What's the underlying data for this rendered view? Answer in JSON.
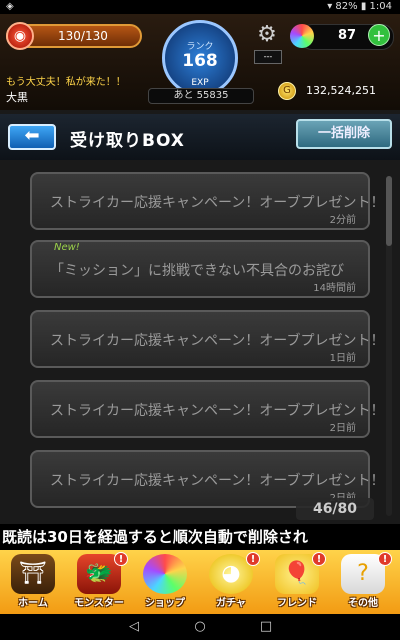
{
  "status_bar": {
    "left_icon": "android-icon",
    "battery": "82%",
    "time": "1:04"
  },
  "player": {
    "hp": "130/130",
    "rank_label": "ランク",
    "rank": "168",
    "exp_label": "EXP",
    "exp_remaining": "あと 55835",
    "orbs": "87",
    "coins": "132,524,251",
    "message": "もう大丈夫！私が来た！！",
    "name": "大黒"
  },
  "header": {
    "title": "受け取りBOX",
    "bulk_delete": "一括削除"
  },
  "mails": [
    {
      "subject": "ストライカー応援キャンペーン！オーブプレゼント！",
      "time": "2分前",
      "new": ""
    },
    {
      "subject": "「ミッション」に挑戦できない不具合のお詫び",
      "time": "14時間前",
      "new": "New!"
    },
    {
      "subject": "ストライカー応援キャンペーン！オーブプレゼント！",
      "time": "1日前",
      "new": ""
    },
    {
      "subject": "ストライカー応援キャンペーン！オーブプレゼント！",
      "time": "2日前",
      "new": ""
    },
    {
      "subject": "ストライカー応援キャンペーン！オーブプレゼント！",
      "time": "2日前",
      "new": ""
    }
  ],
  "mail_count": "46/80",
  "ticker": "既読は30日を経過すると順次自動で削除され",
  "nav": [
    {
      "label": "ホーム",
      "icon": "home-gate-icon"
    },
    {
      "label": "モンスター",
      "icon": "monster-icon",
      "badge": "!"
    },
    {
      "label": "ショップ",
      "icon": "rainbow-orb-icon"
    },
    {
      "label": "ガチャ",
      "icon": "gacha-icon",
      "badge": "!"
    },
    {
      "label": "フレンド",
      "icon": "friend-balloons-icon",
      "badge": "!"
    },
    {
      "label": "その他",
      "icon": "other-icon",
      "badge": "!"
    }
  ],
  "colors": {
    "accent_gold": "#f29b13",
    "hp_orange": "#b65614",
    "rank_blue": "#2d7fd8",
    "bulk_delete_teal": "#2f6a80"
  }
}
